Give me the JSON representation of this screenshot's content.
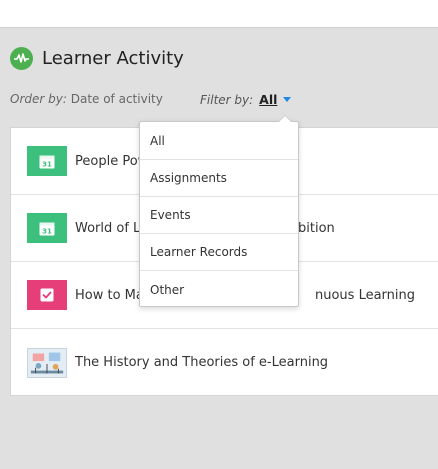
{
  "header": {
    "title": "Learner Activity",
    "icon": "activity-pulse-icon"
  },
  "controls": {
    "order_label": "Order by:",
    "order_value": "Date of activity",
    "filter_label": "Filter by:",
    "filter_value": "All"
  },
  "activities": [
    {
      "title_left": "People Pow",
      "title_right": "",
      "icon": "calendar-31-icon",
      "tile_color": "#3dbf7d"
    },
    {
      "title_left": "World of Le",
      "title_right": "bition",
      "icon": "calendar-31-icon",
      "tile_color": "#3dbf7d"
    },
    {
      "title_left": "How to Ma",
      "title_right": "nuous Learning",
      "icon": "checklist-icon",
      "tile_color": "#e63e78"
    },
    {
      "title_left": "The History and Theories of e-Learning",
      "title_right": "",
      "icon": "thumbnail-image",
      "tile_color": "#dde8f0"
    }
  ],
  "filter_options": [
    "All",
    "Assignments",
    "Events",
    "Learner Records",
    "Other"
  ]
}
